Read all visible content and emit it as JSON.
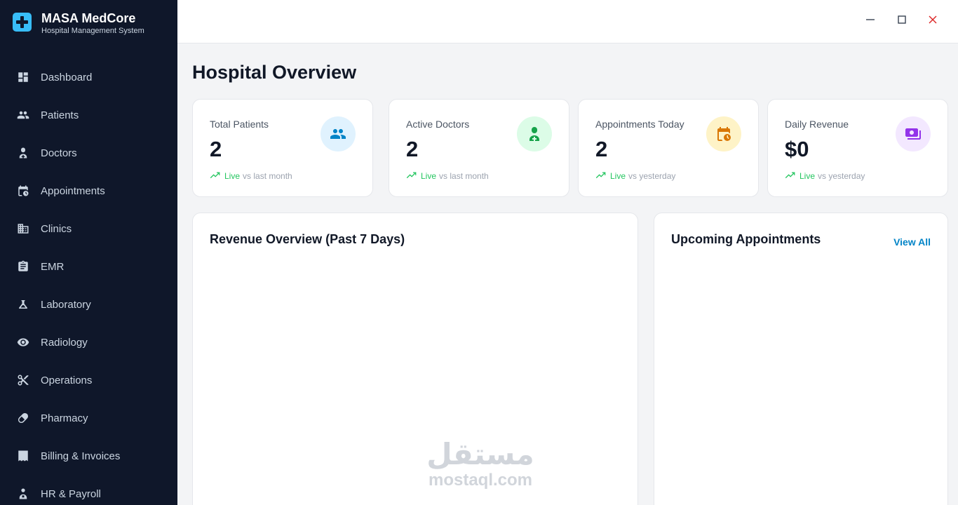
{
  "app": {
    "name": "MASA MedCore",
    "subtitle": "Hospital Management System"
  },
  "sidebar": {
    "items": [
      {
        "label": "Dashboard",
        "icon": "dashboard-icon"
      },
      {
        "label": "Patients",
        "icon": "users-icon"
      },
      {
        "label": "Doctors",
        "icon": "doctor-icon"
      },
      {
        "label": "Appointments",
        "icon": "calendar-clock-icon"
      },
      {
        "label": "Clinics",
        "icon": "building-icon"
      },
      {
        "label": "EMR",
        "icon": "clipboard-icon"
      },
      {
        "label": "Laboratory",
        "icon": "flask-icon"
      },
      {
        "label": "Radiology",
        "icon": "eye-icon"
      },
      {
        "label": "Operations",
        "icon": "scissors-icon"
      },
      {
        "label": "Pharmacy",
        "icon": "pill-icon"
      },
      {
        "label": "Billing & Invoices",
        "icon": "receipt-icon"
      },
      {
        "label": "HR & Payroll",
        "icon": "person-badge-icon"
      }
    ]
  },
  "window": {
    "controls": [
      "minimize-icon",
      "maximize-icon",
      "close-icon"
    ]
  },
  "main": {
    "title": "Hospital Overview",
    "stats": [
      {
        "label": "Total Patients",
        "value": "2",
        "live": "Live",
        "comparison": "vs last month",
        "icon": "users-icon",
        "icon_color": "#0284c7",
        "icon_bg": "#e0f2fe"
      },
      {
        "label": "Active Doctors",
        "value": "2",
        "live": "Live",
        "comparison": "vs last month",
        "icon": "doctor-icon",
        "icon_color": "#16a34a",
        "icon_bg": "#dcfce7"
      },
      {
        "label": "Appointments Today",
        "value": "2",
        "live": "Live",
        "comparison": "vs yesterday",
        "icon": "calendar-clock-icon",
        "icon_color": "#d97706",
        "icon_bg": "#fef3c7"
      },
      {
        "label": "Daily Revenue",
        "value": "$0",
        "live": "Live",
        "comparison": "vs yesterday",
        "icon": "money-icon",
        "icon_color": "#9333ea",
        "icon_bg": "#f3e8ff"
      }
    ],
    "revenue_panel": {
      "title": "Revenue Overview (Past 7 Days)"
    },
    "appointments_panel": {
      "title": "Upcoming Appointments",
      "view_all": "View All"
    }
  },
  "watermark": {
    "arabic": "مستقل",
    "latin": "mostaql.com"
  },
  "colors": {
    "sidebar_bg": "#0f172a",
    "accent": "#38bdf8",
    "trend_green": "#22c55e",
    "link_blue": "#0284c7",
    "close_red": "#dc2626"
  }
}
